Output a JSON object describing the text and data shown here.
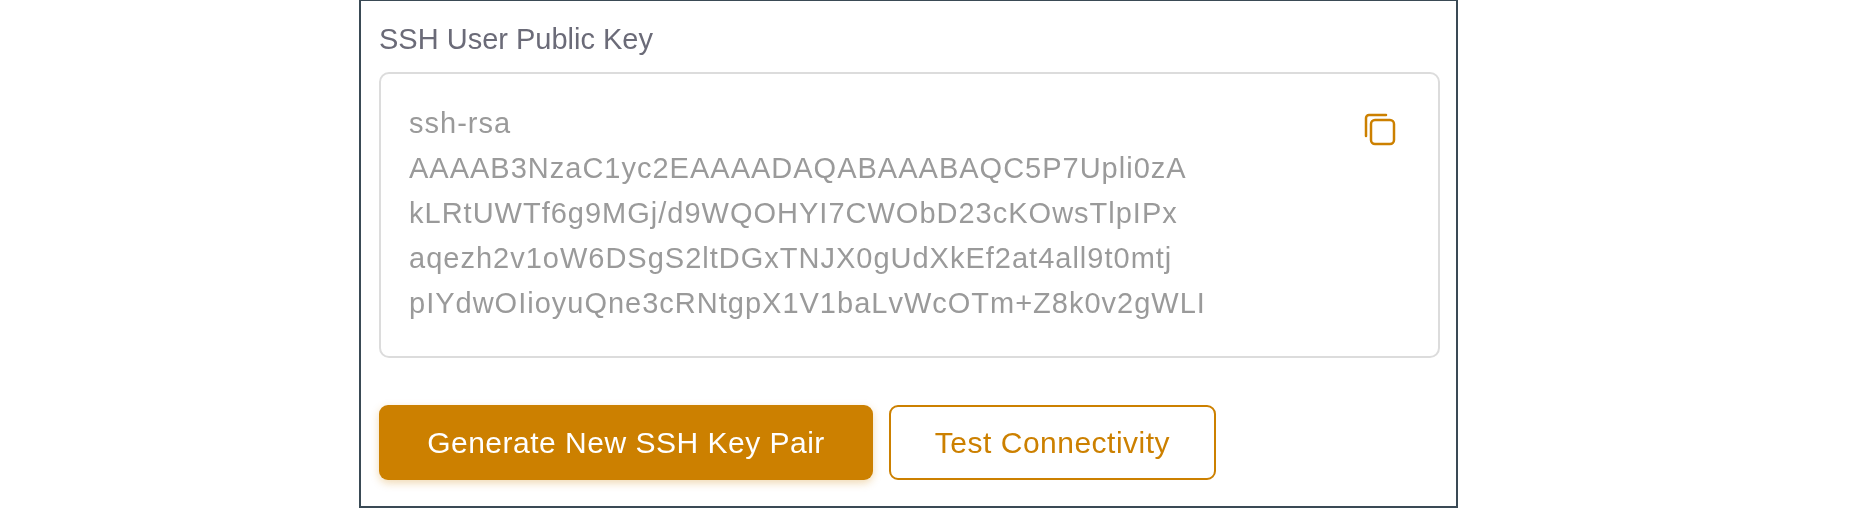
{
  "key_field": {
    "label": "SSH User Public Key",
    "lines": [
      "ssh-rsa",
      "AAAAB3NzaC1yc2EAAAADAQABAAABAQC5P7Upli0zA",
      "kLRtUWTf6g9MGj/d9WQOHYI7CWObD23cKOwsTlpIPx",
      "aqezh2v1oW6DSgS2ltDGxTNJX0gUdXkEf2at4all9t0mtj",
      "pIYdwOIioyuQne3cRNtgpX1V1baLvWcOTm+Z8k0v2gWLI"
    ]
  },
  "buttons": [
    {
      "label": "Generate New SSH Key Pair",
      "kind": "primary"
    },
    {
      "label": "Test Connectivity",
      "kind": "secondary"
    }
  ]
}
